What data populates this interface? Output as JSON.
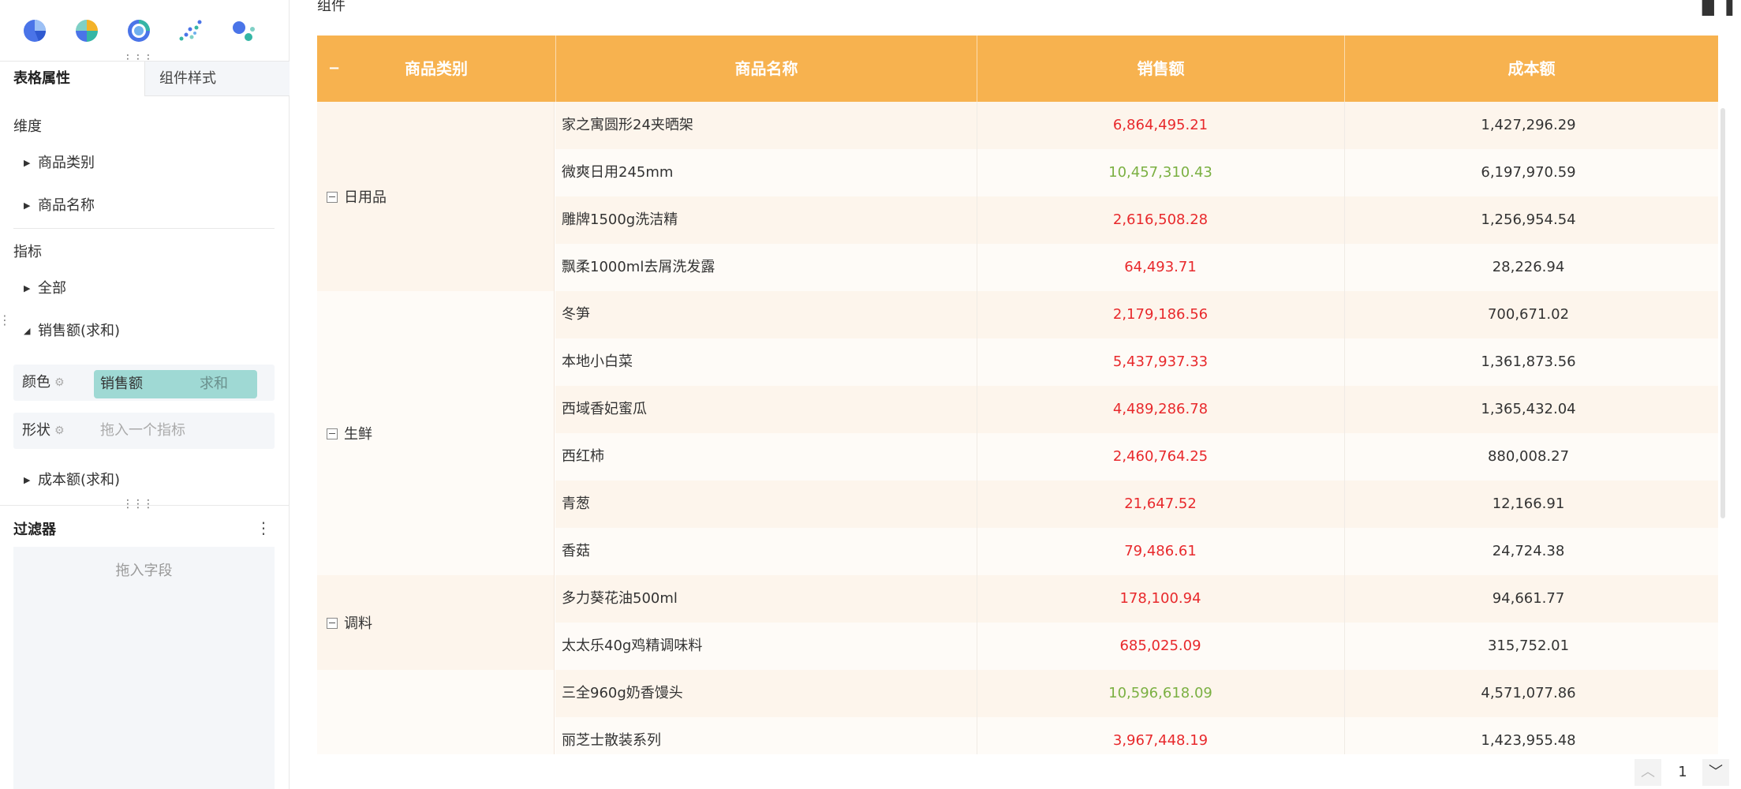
{
  "left_panel": {
    "chart_type_icons": [
      "pie-chart-icon",
      "donut-chart-icon",
      "ring-chart-icon",
      "scatter-chart-icon",
      "bubble-chart-icon"
    ],
    "tabs": {
      "table_props": "表格属性",
      "component_style": "组件样式"
    },
    "dimension": {
      "title": "维度",
      "items": [
        "商品类别",
        "商品名称"
      ]
    },
    "metrics": {
      "title": "指标",
      "items": {
        "all": "全部",
        "sales_sum": "销售额(求和)",
        "cost_sum": "成本额(求和)"
      },
      "color_label": "颜色",
      "color_field": "销售额",
      "color_agg": "求和",
      "shape_label": "形状",
      "shape_placeholder": "拖入一个指标"
    },
    "filter": {
      "title": "过滤器",
      "placeholder": "拖入字段"
    }
  },
  "component": {
    "title": "组件"
  },
  "table": {
    "colors": {
      "header_bg": "#f7b24f",
      "row_odd": "#fdf5ec",
      "row_even": "#fefbf7",
      "sales_red": "#e8292c",
      "sales_green": "#7bb042"
    },
    "columns": [
      "商品类别",
      "商品名称",
      "销售额",
      "成本额"
    ],
    "collapse_symbol": "−",
    "groups": [
      {
        "category": "日用品",
        "rows": [
          {
            "name": "家之寓圆形24夹晒架",
            "sales": "6,864,495.21",
            "cost": "1,427,296.29",
            "sales_color": "red"
          },
          {
            "name": "微爽日用245mm",
            "sales": "10,457,310.43",
            "cost": "6,197,970.59",
            "sales_color": "green"
          },
          {
            "name": "雕牌1500g洗洁精",
            "sales": "2,616,508.28",
            "cost": "1,256,954.54",
            "sales_color": "red"
          },
          {
            "name": "飘柔1000ml去屑洗发露",
            "sales": "64,493.71",
            "cost": "28,226.94",
            "sales_color": "red"
          }
        ]
      },
      {
        "category": "生鲜",
        "rows": [
          {
            "name": "冬笋",
            "sales": "2,179,186.56",
            "cost": "700,671.02",
            "sales_color": "red"
          },
          {
            "name": "本地小白菜",
            "sales": "5,437,937.33",
            "cost": "1,361,873.56",
            "sales_color": "red"
          },
          {
            "name": "西域香妃蜜瓜",
            "sales": "4,489,286.78",
            "cost": "1,365,432.04",
            "sales_color": "red"
          },
          {
            "name": "西红柿",
            "sales": "2,460,764.25",
            "cost": "880,008.27",
            "sales_color": "red"
          },
          {
            "name": "青葱",
            "sales": "21,647.52",
            "cost": "12,166.91",
            "sales_color": "red"
          },
          {
            "name": "香菇",
            "sales": "79,486.61",
            "cost": "24,724.38",
            "sales_color": "red"
          }
        ]
      },
      {
        "category": "调料",
        "rows": [
          {
            "name": "多力葵花油500ml",
            "sales": "178,100.94",
            "cost": "94,661.77",
            "sales_color": "red"
          },
          {
            "name": "太太乐40g鸡精调味料",
            "sales": "685,025.09",
            "cost": "315,752.01",
            "sales_color": "red"
          }
        ]
      },
      {
        "category": "",
        "rows": [
          {
            "name": "三全960g奶香馒头",
            "sales": "10,596,618.09",
            "cost": "4,571,077.86",
            "sales_color": "green"
          },
          {
            "name": "丽芝士散装系列",
            "sales": "3,967,448.19",
            "cost": "1,423,955.48",
            "sales_color": "red"
          }
        ]
      }
    ]
  },
  "pager": {
    "page": "1"
  }
}
